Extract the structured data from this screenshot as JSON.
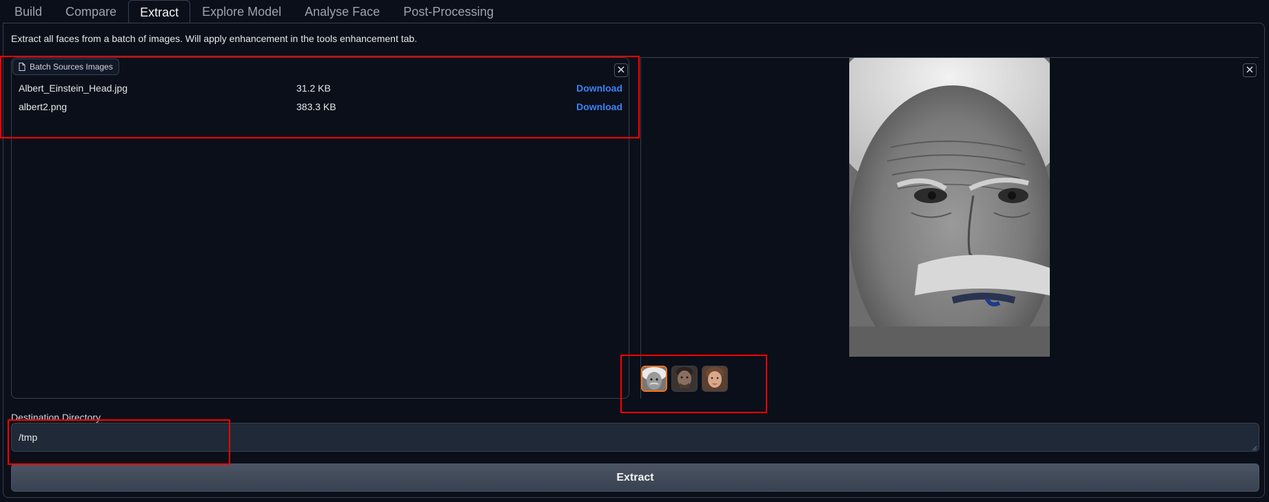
{
  "tabs": [
    {
      "label": "Build",
      "active": false
    },
    {
      "label": "Compare",
      "active": false
    },
    {
      "label": "Extract",
      "active": true
    },
    {
      "label": "Explore Model",
      "active": false
    },
    {
      "label": "Analyse Face",
      "active": false
    },
    {
      "label": "Post-Processing",
      "active": false
    }
  ],
  "description": "Extract all faces from a batch of images. Will apply enhancement in the tools enhancement tab.",
  "batch_sources": {
    "label": "Batch Sources Images",
    "files": [
      {
        "name": "Albert_Einstein_Head.jpg",
        "size": "31.2 KB",
        "action": "Download"
      },
      {
        "name": "albert2.png",
        "size": "383.3 KB",
        "action": "Download"
      }
    ]
  },
  "gallery": {
    "selected_index": 0,
    "thumbnails": [
      "face-thumbnail-1",
      "face-thumbnail-2",
      "face-thumbnail-3"
    ]
  },
  "destination": {
    "label": "Destination Directory",
    "value": "/tmp"
  },
  "extract_button": "Extract",
  "colors": {
    "background": "#0b0f19",
    "border": "#374151",
    "accent_link": "#3b82f6",
    "selected_thumb": "#f97316",
    "annotation": "#ff0000"
  }
}
